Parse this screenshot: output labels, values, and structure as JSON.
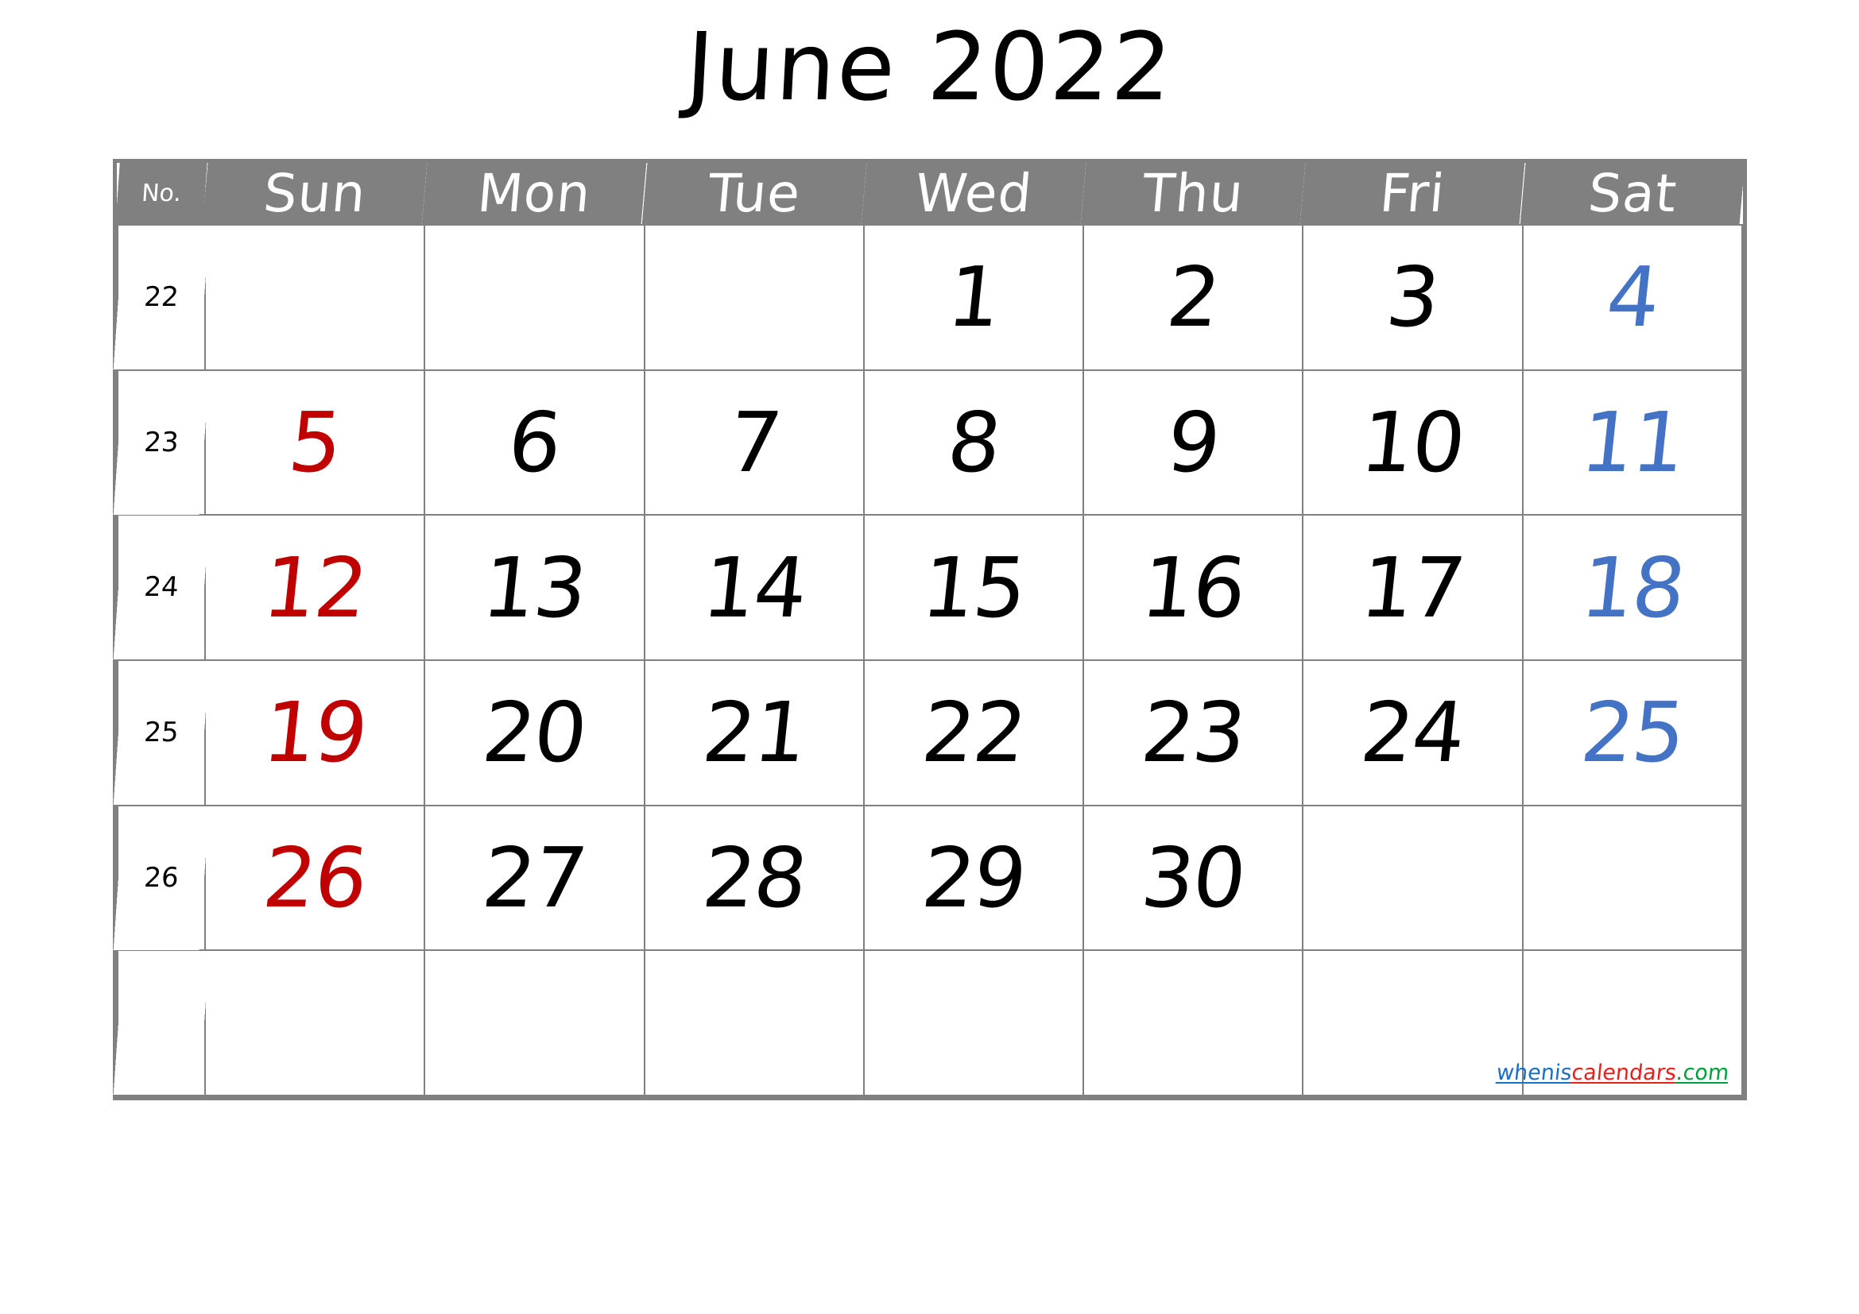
{
  "title": "June 2022",
  "header": {
    "week_number_label": "No.",
    "days": [
      "Sun",
      "Mon",
      "Tue",
      "Wed",
      "Thu",
      "Fri",
      "Sat"
    ]
  },
  "colors": {
    "header_bg": "#808080",
    "header_text": "#ffffff",
    "grid_line": "#808080",
    "weekday": "#000000",
    "sunday": "#C00000",
    "saturday": "#4472C4"
  },
  "weeks": [
    {
      "number": "22",
      "days": [
        {
          "value": "",
          "color": "black"
        },
        {
          "value": "",
          "color": "black"
        },
        {
          "value": "",
          "color": "black"
        },
        {
          "value": "1",
          "color": "black"
        },
        {
          "value": "2",
          "color": "black"
        },
        {
          "value": "3",
          "color": "black"
        },
        {
          "value": "4",
          "color": "blue"
        }
      ]
    },
    {
      "number": "23",
      "days": [
        {
          "value": "5",
          "color": "red"
        },
        {
          "value": "6",
          "color": "black"
        },
        {
          "value": "7",
          "color": "black"
        },
        {
          "value": "8",
          "color": "black"
        },
        {
          "value": "9",
          "color": "black"
        },
        {
          "value": "10",
          "color": "black"
        },
        {
          "value": "11",
          "color": "blue"
        }
      ]
    },
    {
      "number": "24",
      "days": [
        {
          "value": "12",
          "color": "red"
        },
        {
          "value": "13",
          "color": "black"
        },
        {
          "value": "14",
          "color": "black"
        },
        {
          "value": "15",
          "color": "black"
        },
        {
          "value": "16",
          "color": "black"
        },
        {
          "value": "17",
          "color": "black"
        },
        {
          "value": "18",
          "color": "blue"
        }
      ]
    },
    {
      "number": "25",
      "days": [
        {
          "value": "19",
          "color": "red"
        },
        {
          "value": "20",
          "color": "black"
        },
        {
          "value": "21",
          "color": "black"
        },
        {
          "value": "22",
          "color": "black"
        },
        {
          "value": "23",
          "color": "black"
        },
        {
          "value": "24",
          "color": "black"
        },
        {
          "value": "25",
          "color": "blue"
        }
      ]
    },
    {
      "number": "26",
      "days": [
        {
          "value": "26",
          "color": "red"
        },
        {
          "value": "27",
          "color": "black"
        },
        {
          "value": "28",
          "color": "black"
        },
        {
          "value": "29",
          "color": "black"
        },
        {
          "value": "30",
          "color": "black"
        },
        {
          "value": "",
          "color": "black"
        },
        {
          "value": "",
          "color": "black"
        }
      ]
    },
    {
      "number": "",
      "days": [
        {
          "value": "",
          "color": "black"
        },
        {
          "value": "",
          "color": "black"
        },
        {
          "value": "",
          "color": "black"
        },
        {
          "value": "",
          "color": "black"
        },
        {
          "value": "",
          "color": "black"
        },
        {
          "value": "",
          "color": "black"
        },
        {
          "value": "",
          "color": "black"
        }
      ]
    }
  ],
  "watermark": {
    "part1": "whenis",
    "part2": "calendars",
    "part3": ".com"
  }
}
